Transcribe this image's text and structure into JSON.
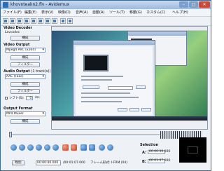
{
  "window": {
    "title": "khovnteakn2.flv - Avidemux"
  },
  "menus": [
    "ファイル(F)",
    "編集(E)",
    "表示(V)",
    "映像(D)",
    "音声(A)",
    "自動(A)",
    "ツール(T)",
    "移動(G)",
    "カスタム(C)",
    "ヘルプ(H)"
  ],
  "sidebar": {
    "video_decoder": {
      "title": "Video Decoder",
      "codec": "Lavcodec",
      "config_label": "構成"
    },
    "video_output": {
      "title": "Video Output",
      "selected": "Mpeg4 AVC (x264)",
      "config_label": "構成",
      "filter_label": "フィルター"
    },
    "audio_output": {
      "title": "Audio Output",
      "track_info": "(1 track(s))",
      "selected": "AAC (Faac)",
      "config_label": "構成",
      "filter_label": "フィルター",
      "shift_label": "シフト(S):",
      "shift_value": "0",
      "shift_unit": "ms"
    },
    "output_format": {
      "title": "Output Format",
      "selected": "MP4 Muxer",
      "config_label": "構成"
    }
  },
  "footer": {
    "time_button": "時間:",
    "current_time": "00:00:00.000",
    "total_time": "/00:01:07.000",
    "frame_type": "フレーム形式: I-FRM (04)",
    "selection_title": "Selection",
    "a_label": "A:",
    "a_value": "00:00:00.000",
    "b_label": "B:",
    "b_value": "00:01:07.000"
  },
  "colors": {
    "titlebar": "#9fbadd",
    "close": "#c94a3b",
    "control_blue": "#2d64ad",
    "control_red": "#c2401e"
  }
}
